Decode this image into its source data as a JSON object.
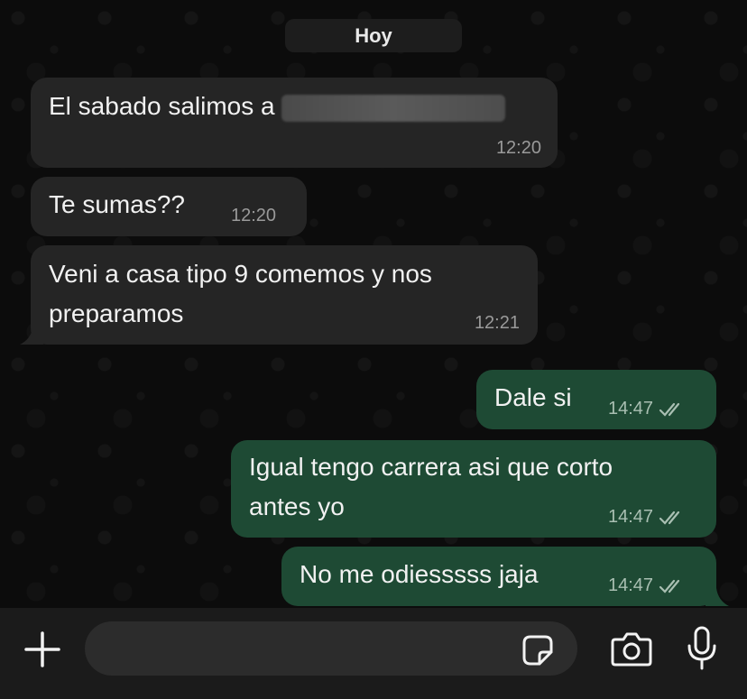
{
  "chat": {
    "date_divider": "Hoy",
    "messages": [
      {
        "direction": "incoming",
        "lines": [
          "El sabado salimos a"
        ],
        "has_redaction": true,
        "time": "12:20"
      },
      {
        "direction": "incoming",
        "lines": [
          "Te sumas??"
        ],
        "time": "12:20"
      },
      {
        "direction": "incoming",
        "lines": [
          "Veni a casa tipo 9 comemos y nos",
          "preparamos"
        ],
        "time": "12:21"
      },
      {
        "direction": "outgoing",
        "lines": [
          "Dale si"
        ],
        "time": "14:47",
        "status": "read-double-check"
      },
      {
        "direction": "outgoing",
        "lines": [
          "Igual tengo carrera asi que corto",
          "antes yo"
        ],
        "time": "14:47",
        "status": "read-double-check"
      },
      {
        "direction": "outgoing",
        "lines": [
          "No me odiesssss jaja"
        ],
        "time": "14:47",
        "status": "read-double-check"
      }
    ]
  },
  "input_bar": {
    "message_value": "",
    "icons": {
      "attach": "plus-icon",
      "sticker": "sticker-icon",
      "camera": "camera-icon",
      "voice": "microphone-icon"
    }
  },
  "colors": {
    "incoming_bubble": "#252525",
    "outgoing_bubble": "#1e4a34",
    "background": "#0c0c0c",
    "input_bar": "#1b1b1b"
  }
}
